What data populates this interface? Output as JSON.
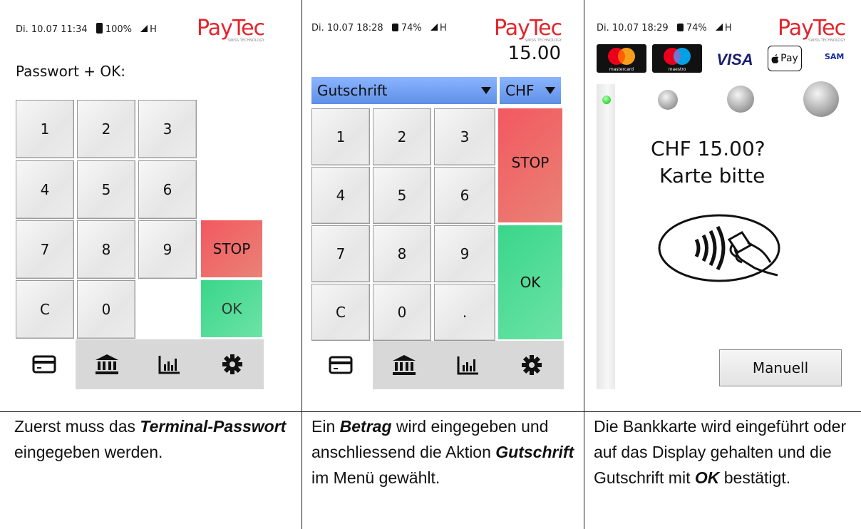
{
  "brand": "PayTec",
  "brand_tagline": "SWISS TECHNOLOGY",
  "colors": {
    "stop": "#ee6168",
    "ok": "#4fdc98",
    "dropdown": "#79a6f6",
    "logo": "#e3242b",
    "led": "#3fdc3f"
  },
  "panels": [
    {
      "status": {
        "datetime": "Di. 10.07 11:34",
        "battery": "100%",
        "network": "H"
      },
      "prompt": "Passwort + OK:",
      "keys": [
        "1",
        "2",
        "3",
        "4",
        "5",
        "6",
        "7",
        "8",
        "9",
        "C",
        "0"
      ],
      "stop_label": "STOP",
      "ok_label": "OK",
      "tabs": [
        "card-icon",
        "bank-icon",
        "chart-icon",
        "gear-icon"
      ],
      "caption_parts": [
        "Zuerst muss das ",
        "Terminal-Passwort",
        " eingegeben werden."
      ]
    },
    {
      "status": {
        "datetime": "Di. 10.07 18:28",
        "battery": "74%",
        "network": "H"
      },
      "amount": "15.00",
      "transaction_type": "Gutschrift",
      "currency": "CHF",
      "keys": [
        "1",
        "2",
        "3",
        "4",
        "5",
        "6",
        "7",
        "8",
        "9",
        "C",
        "0",
        "."
      ],
      "stop_label": "STOP",
      "ok_label": "OK",
      "tabs": [
        "card-icon",
        "bank-icon",
        "chart-icon",
        "gear-icon"
      ],
      "caption_parts": [
        "Ein ",
        "Betrag",
        " wird eingegeben und anschliessend die Aktion ",
        "Gutschrift",
        " im Menü gewählt."
      ]
    },
    {
      "status": {
        "datetime": "Di. 10.07 18:29",
        "battery": "74%",
        "network": "H"
      },
      "card_logos": [
        "mastercard",
        "maestro",
        "VISA",
        "Pay",
        "SAM P"
      ],
      "message_line1": "CHF 15.00?",
      "message_line2": "Karte bitte",
      "manual_button": "Manuell",
      "caption_parts": [
        "Die Bankkarte wird eingeführt oder auf das Display gehalten und die Gutschrift mit ",
        "OK",
        " bestätigt."
      ]
    }
  ]
}
